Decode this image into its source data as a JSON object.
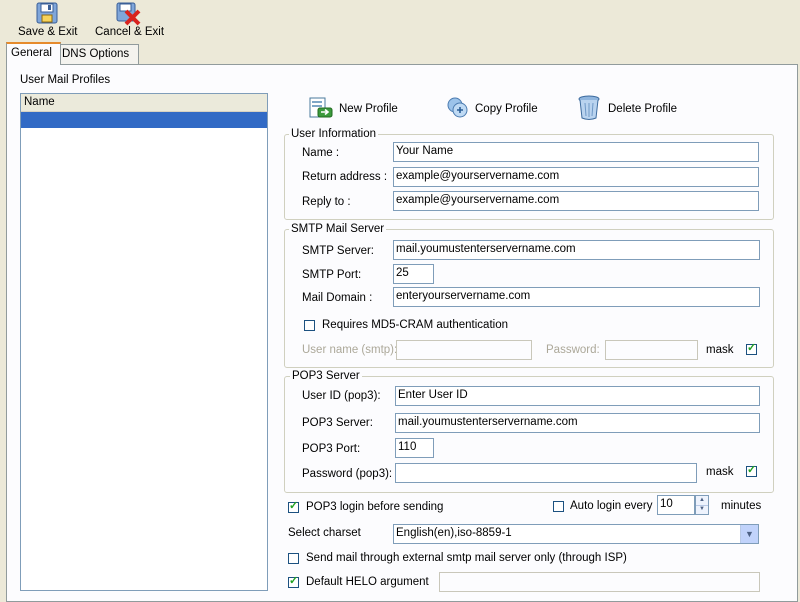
{
  "toolbar": {
    "save_label": "Save & Exit",
    "cancel_label": "Cancel & Exit"
  },
  "tabs": [
    {
      "label": "General",
      "active": true
    },
    {
      "label": "DNS Options",
      "active": false
    }
  ],
  "profiles": {
    "label": "User Mail Profiles",
    "column_header": "Name",
    "rows": [
      ""
    ]
  },
  "actions": {
    "new_profile": "New Profile",
    "copy_profile": "Copy Profile",
    "delete_profile": "Delete Profile"
  },
  "user_info": {
    "title": "User Information",
    "name_label": "Name :",
    "name_value": "Your Name",
    "return_label": "Return address :",
    "return_value": "example@yourservername.com",
    "reply_label": "Reply to :",
    "reply_value": "example@yourservername.com"
  },
  "smtp": {
    "title": "SMTP Mail Server",
    "server_label": "SMTP Server:",
    "server_value": "mail.youmustenterservername.com",
    "port_label": "SMTP Port:",
    "port_value": "25",
    "domain_label": "Mail Domain :",
    "domain_value": "enteryourservername.com",
    "md5_label": "Requires MD5-CRAM authentication",
    "md5_checked": false,
    "user_label": "User name (smtp):",
    "user_value": "",
    "password_label": "Password:",
    "password_value": "",
    "mask_label": "mask",
    "mask_checked": true
  },
  "pop3": {
    "title": "POP3 Server",
    "userid_label": "User ID (pop3):",
    "userid_value": "Enter User ID",
    "server_label": "POP3 Server:",
    "server_value": "mail.youmustenterservername.com",
    "port_label": "POP3 Port:",
    "port_value": "110",
    "password_label": "Password (pop3):",
    "password_value": "",
    "mask_label": "mask",
    "mask_checked": true
  },
  "options": {
    "pop3_before_label": "POP3 login before sending",
    "pop3_before_checked": true,
    "auto_login_label": "Auto login every",
    "auto_login_checked": false,
    "auto_login_value": "10",
    "minutes_label": "minutes",
    "charset_label": "Select charset",
    "charset_value": "English(en),iso-8859-1",
    "external_label": "Send mail through external smtp mail server only (through ISP)",
    "external_checked": false,
    "helo_label": "Default HELO argument",
    "helo_checked": true,
    "helo_value": ""
  },
  "colors": {
    "window_bg": "#ECE9D8",
    "selection": "#316AC5",
    "border": "#7F9DB9"
  },
  "icons": [
    "save-icon",
    "cancel-icon",
    "new-profile-icon",
    "copy-profile-icon",
    "delete-profile-icon"
  ]
}
